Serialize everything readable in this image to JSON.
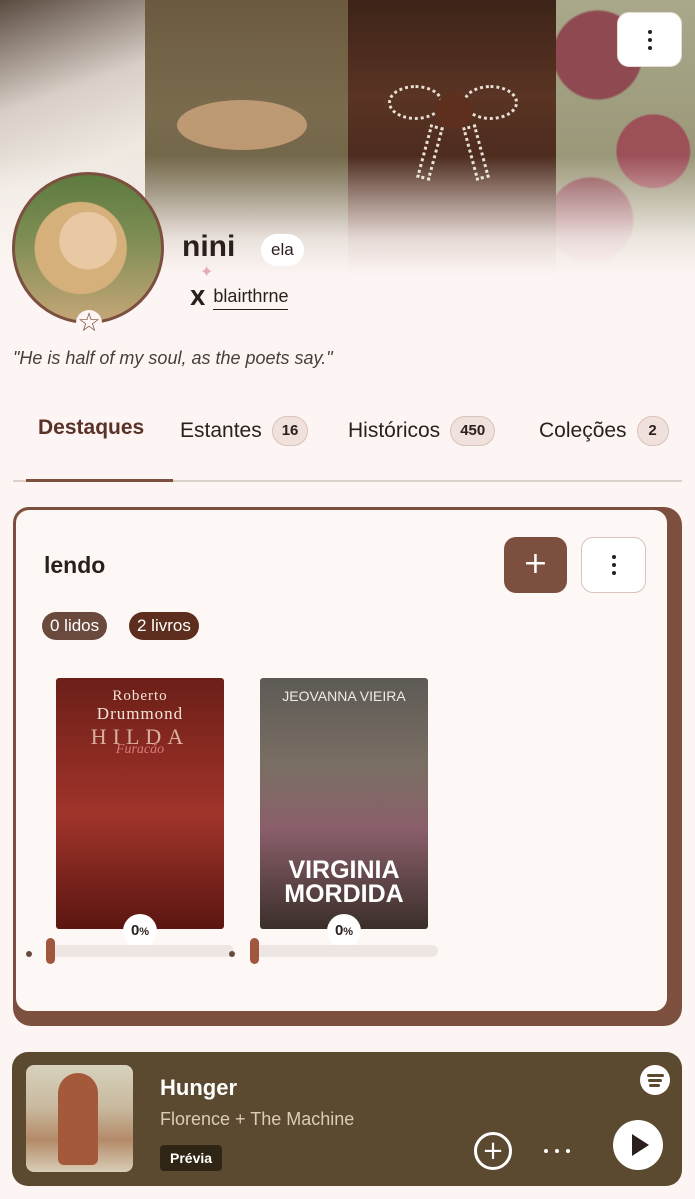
{
  "profile": {
    "username": "nini",
    "pronoun": "ela",
    "x_handle": "blairthrne",
    "bio": "\"He is half of my soul, as the poets say.\""
  },
  "icons": {
    "menu": "more-vertical-icon",
    "social": "x-logo-icon",
    "avatar_badge": "star-icon",
    "sparkle": "sparkle-icon",
    "add": "plus-icon",
    "spotify": "spotify-icon",
    "add_circle": "plus-circle-icon",
    "more_horizontal": "more-horizontal-icon",
    "play": "play-icon"
  },
  "glyphs": {
    "x": "X",
    "star": "☆",
    "sparkle": "✦",
    "plus": "+",
    "circle_plus": "+"
  },
  "tabs": [
    {
      "label": "Destaques",
      "count": null,
      "active": true
    },
    {
      "label": "Estantes",
      "count": "16"
    },
    {
      "label": "Históricos",
      "count": "450"
    },
    {
      "label": "Coleções",
      "count": "2"
    }
  ],
  "shelf": {
    "title": "lendo",
    "read_count": "0 lidos",
    "book_count": "2 livros",
    "books": [
      {
        "author": "Roberto",
        "author2": "Drummond",
        "title": "HILDA",
        "subtitle": "Furacão",
        "progress_pct": "0",
        "progress_unit": "%",
        "progress": 0
      },
      {
        "author": "JEOVANNA VIEIRA",
        "title": "VIRGINIA",
        "title2": "MORDIDA",
        "progress_pct": "0",
        "progress_unit": "%",
        "progress": 0
      }
    ]
  },
  "player": {
    "title": "Hunger",
    "artist": "Florence + The Machine",
    "badge": "Prévia"
  },
  "colors": {
    "accent": "#7d4f3e",
    "background": "#fcf5f3",
    "player_bg": "#5b4a30"
  }
}
